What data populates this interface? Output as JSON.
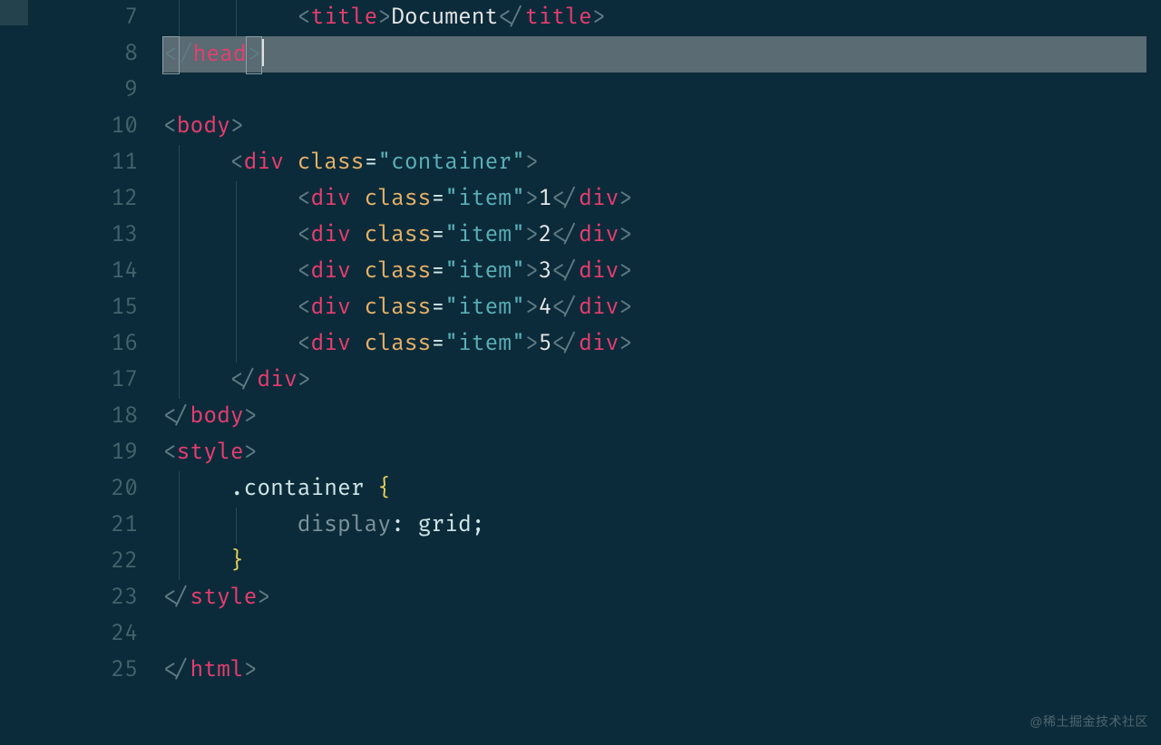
{
  "gutter": {
    "start": 7,
    "end": 25
  },
  "highlighted_line": 8,
  "lines": {
    "l7": {
      "indent_units": 2,
      "parts": [
        {
          "t": "angle",
          "v": "<"
        },
        {
          "t": "tag",
          "v": "title"
        },
        {
          "t": "angle",
          "v": ">"
        },
        {
          "t": "text",
          "v": "Document"
        },
        {
          "t": "angle",
          "v": "</"
        },
        {
          "t": "tag",
          "v": "title"
        },
        {
          "t": "angle",
          "v": ">"
        }
      ]
    },
    "l8": {
      "indent_units": 0,
      "highlighted": true,
      "parts": [
        {
          "t": "angle",
          "v": "<",
          "box": true
        },
        {
          "t": "angle",
          "v": "/"
        },
        {
          "t": "tag",
          "v": "head"
        },
        {
          "t": "angle",
          "v": ">",
          "box": true
        },
        {
          "t": "cursor"
        }
      ]
    },
    "l9": {
      "indent_units": 0,
      "parts": []
    },
    "l10": {
      "indent_units": 0,
      "parts": [
        {
          "t": "angle",
          "v": "<"
        },
        {
          "t": "tag",
          "v": "body"
        },
        {
          "t": "angle",
          "v": ">"
        }
      ]
    },
    "l11": {
      "indent_units": 1,
      "parts": [
        {
          "t": "angle",
          "v": "<"
        },
        {
          "t": "tag",
          "v": "div"
        },
        {
          "t": "text",
          "v": " "
        },
        {
          "t": "attr",
          "v": "class"
        },
        {
          "t": "eq",
          "v": "="
        },
        {
          "t": "str",
          "v": "\"container\""
        },
        {
          "t": "angle",
          "v": ">"
        }
      ]
    },
    "l12": {
      "indent_units": 2,
      "item_text": "1"
    },
    "l13": {
      "indent_units": 2,
      "item_text": "2"
    },
    "l14": {
      "indent_units": 2,
      "item_text": "3"
    },
    "l15": {
      "indent_units": 2,
      "item_text": "4"
    },
    "l16": {
      "indent_units": 2,
      "item_text": "5"
    },
    "l17": {
      "indent_units": 1,
      "parts": [
        {
          "t": "angle",
          "v": "</"
        },
        {
          "t": "tag",
          "v": "div"
        },
        {
          "t": "angle",
          "v": ">"
        }
      ]
    },
    "l18": {
      "indent_units": 0,
      "parts": [
        {
          "t": "angle",
          "v": "</"
        },
        {
          "t": "tag",
          "v": "body"
        },
        {
          "t": "angle",
          "v": ">"
        }
      ]
    },
    "l19": {
      "indent_units": 0,
      "parts": [
        {
          "t": "angle",
          "v": "<"
        },
        {
          "t": "tag",
          "v": "style"
        },
        {
          "t": "angle",
          "v": ">"
        }
      ]
    },
    "l20": {
      "indent_units": 1,
      "parts": [
        {
          "t": "sel",
          "v": ".container "
        },
        {
          "t": "brace",
          "v": "{"
        }
      ]
    },
    "l21": {
      "indent_units": 2,
      "parts": [
        {
          "t": "prop",
          "v": "display"
        },
        {
          "t": "punct",
          "v": ": "
        },
        {
          "t": "val",
          "v": "grid"
        },
        {
          "t": "punct",
          "v": ";"
        }
      ]
    },
    "l22": {
      "indent_units": 1,
      "parts": [
        {
          "t": "brace",
          "v": "}"
        }
      ]
    },
    "l23": {
      "indent_units": 0,
      "parts": [
        {
          "t": "angle",
          "v": "</"
        },
        {
          "t": "tag",
          "v": "style"
        },
        {
          "t": "angle",
          "v": ">"
        }
      ]
    },
    "l24": {
      "indent_units": 0,
      "parts": []
    },
    "l25": {
      "indent_units": 0,
      "parts": [
        {
          "t": "angle",
          "v": "</"
        },
        {
          "t": "tag",
          "v": "html"
        },
        {
          "t": "angle",
          "v": ">"
        }
      ]
    }
  },
  "item_template": {
    "open_angle": "<",
    "tag": "div",
    "space": " ",
    "attr": "class",
    "eq": "=",
    "str": "\"item\"",
    "close_angle": ">",
    "close_open": "</",
    "close_close": ">"
  },
  "watermark": "@稀土掘金技术社区"
}
